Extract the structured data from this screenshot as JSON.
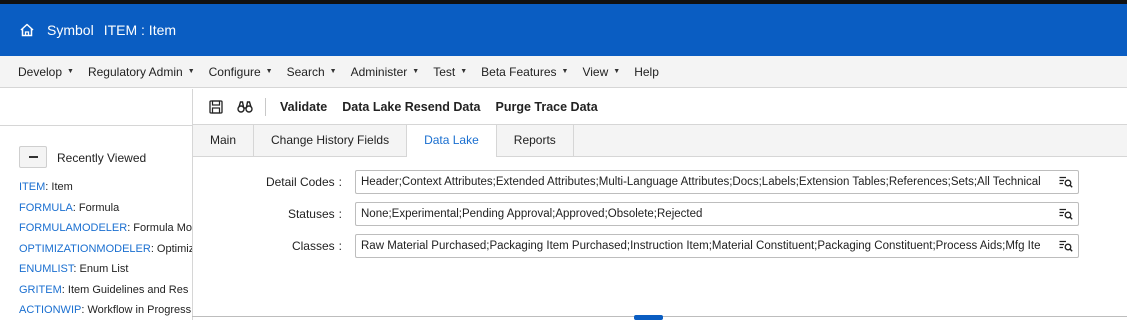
{
  "header": {
    "brand": "Symbol",
    "title": "ITEM : Item"
  },
  "menu": {
    "items": [
      {
        "label": "Develop",
        "dropdown": true
      },
      {
        "label": "Regulatory Admin",
        "dropdown": true
      },
      {
        "label": "Configure",
        "dropdown": true
      },
      {
        "label": "Search",
        "dropdown": true
      },
      {
        "label": "Administer",
        "dropdown": true
      },
      {
        "label": "Test",
        "dropdown": true
      },
      {
        "label": "Beta Features",
        "dropdown": true
      },
      {
        "label": "View",
        "dropdown": true
      },
      {
        "label": "Help",
        "dropdown": false
      }
    ]
  },
  "toolbar": {
    "validate": "Validate",
    "resend": "Data Lake Resend Data",
    "purge": "Purge Trace Data"
  },
  "tabs": [
    {
      "label": "Main",
      "active": false
    },
    {
      "label": "Change History Fields",
      "active": false
    },
    {
      "label": "Data Lake",
      "active": true
    },
    {
      "label": "Reports",
      "active": false
    }
  ],
  "recent": {
    "title": "Recently Viewed",
    "items": [
      {
        "key": "ITEM",
        "desc": ": Item"
      },
      {
        "key": "FORMULA",
        "desc": ": Formula"
      },
      {
        "key": "FORMULAMODELER",
        "desc": ": Formula Mo"
      },
      {
        "key": "OPTIMIZATIONMODELER",
        "desc": ": Optimiz"
      },
      {
        "key": "ENUMLIST",
        "desc": ": Enum List"
      },
      {
        "key": "GRITEM",
        "desc": ": Item Guidelines and Res"
      },
      {
        "key": "ACTIONWIP",
        "desc": ": Workflow in Progress"
      }
    ]
  },
  "form": {
    "detail_codes": {
      "label": "Detail Codes",
      "value": "Header;Context Attributes;Extended Attributes;Multi-Language Attributes;Docs;Labels;Extension Tables;References;Sets;All Technical"
    },
    "statuses": {
      "label": "Statuses",
      "value": "None;Experimental;Pending Approval;Approved;Obsolete;Rejected"
    },
    "classes": {
      "label": "Classes",
      "value": "Raw Material Purchased;Packaging Item Purchased;Instruction Item;Material Constituent;Packaging Constituent;Process Aids;Mfg Ite"
    }
  },
  "colors": {
    "header_bg": "#0a5dc2",
    "link": "#1a6fd0",
    "active_tab": "#1a6fd0"
  }
}
